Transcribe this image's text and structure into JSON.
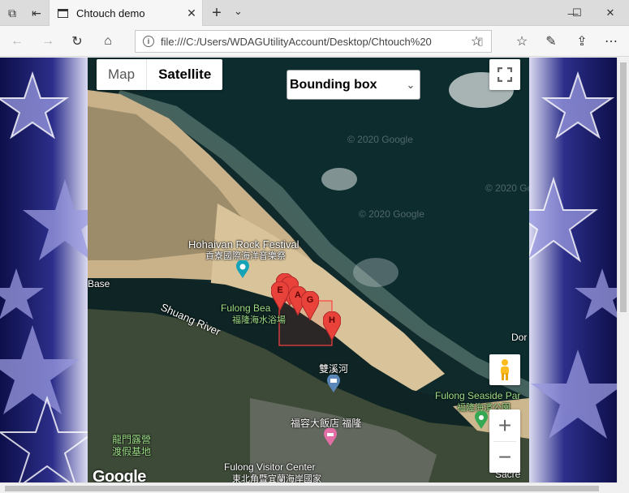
{
  "browser": {
    "tab_title": "Chtouch demo",
    "url": "file:///C:/Users/WDAGUtilityAccount/Desktop/Chtouch%20"
  },
  "map": {
    "type_options": [
      "Map",
      "Satellite"
    ],
    "selected_type": "Satellite",
    "mode_select_value": "Bounding box",
    "watermark": "© 2020 Google",
    "attribution_logo": "Google",
    "labels": {
      "festival": "Hohaivan Rock Festival",
      "festival_zh": "貢寮國際海洋音樂祭",
      "base": "Base",
      "river": "Shuang River",
      "beach": "Fulong Bea",
      "beach_zh": "福隆海水浴場",
      "stream_zh": "雙溪河",
      "hotel_zh": "福容大飯店 福隆",
      "seaside_park": "Fulong Seaside Par",
      "seaside_park_zh": "福隆海濱公園",
      "camp_zh_1": "龍門露營",
      "camp_zh_2": "渡假基地",
      "visitor_center": "Fulong Visitor Center",
      "visitor_center_zh": "東北角暨宜蘭海岸國家",
      "dor": "Dor",
      "sacred": "Sacre"
    },
    "markers": [
      {
        "label": "E"
      },
      {
        "label": "A"
      },
      {
        "label": "G"
      },
      {
        "label": "H"
      }
    ],
    "marker_color": "#e8423a",
    "bbox_color": "#ff4040"
  }
}
